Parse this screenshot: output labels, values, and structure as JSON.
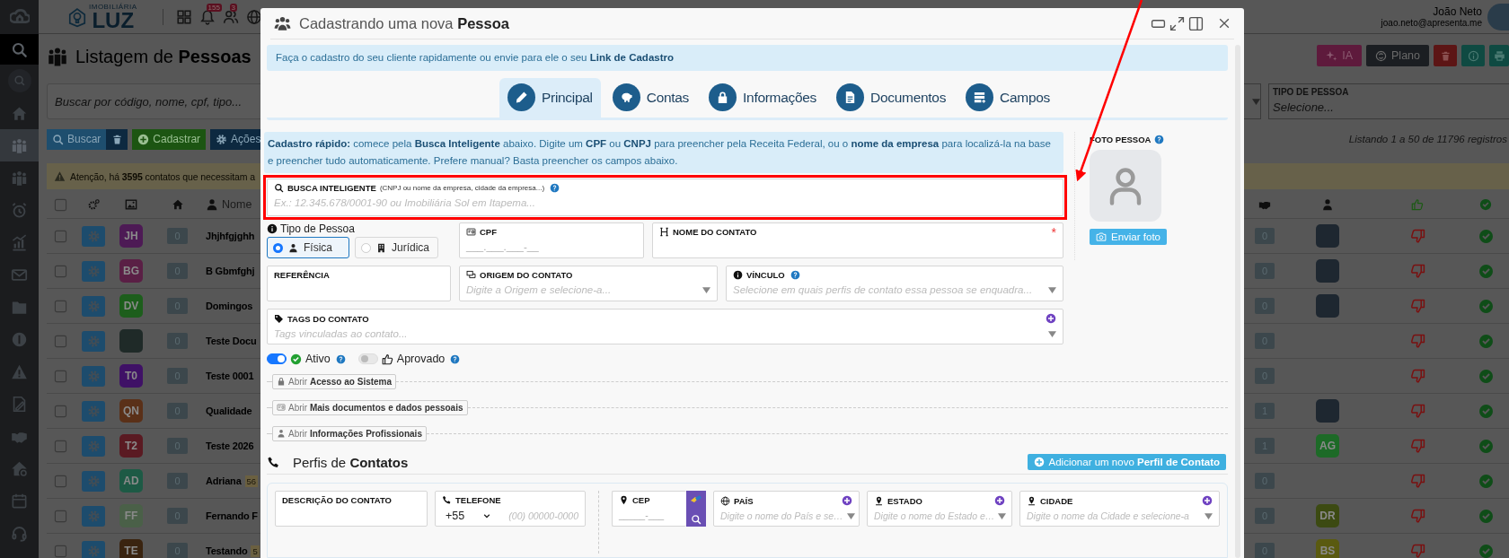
{
  "sidebar": {
    "items": [
      {
        "selected": false
      },
      {
        "selected": false
      },
      {
        "selected": false
      },
      {
        "selected": true
      },
      {
        "selected": false
      },
      {
        "selected": false
      },
      {
        "selected": false
      },
      {
        "selected": false
      },
      {
        "selected": false
      },
      {
        "selected": false
      },
      {
        "selected": false
      },
      {
        "selected": false
      },
      {
        "selected": false
      },
      {
        "selected": false
      },
      {
        "selected": false
      },
      {
        "selected": false
      }
    ]
  },
  "topbar": {
    "logo_small": "IMOBILIÁRIA",
    "logo": "LUZ",
    "badges": [
      "155",
      "3"
    ],
    "user_name": "João Neto",
    "user_email": "joao.neto@apresenta.me"
  },
  "page": {
    "title": "Listagem de **Pessoas**",
    "top_buttons": [
      "IA",
      "Plano"
    ],
    "search_placeholder": "Buscar por código, nome, cpf, tipo...",
    "filter": {
      "label": "TIPO DE PESSOA",
      "placeholder": "Selecione..."
    },
    "buttons": [
      "Buscar",
      "Cadastrar",
      "Ações"
    ],
    "listing": "Listando 1 a 50 de 11796 registros",
    "warning": "Atenção, há **3595** contatos que necessitam a"
  },
  "table": {
    "all_checked": false,
    "name_column": "Nome",
    "rows": [
      {
        "checked": false,
        "avatar": {
          "kind": "initials",
          "initials": "JH",
          "color": "#4d1a55"
        },
        "count": "0",
        "name": "Jhjhfgjghh",
        "right_count": "0",
        "owner": {
          "kind": "photo"
        },
        "approved": false,
        "active": true
      },
      {
        "checked": false,
        "avatar": {
          "kind": "initials",
          "initials": "BG",
          "color": "#5a1f45"
        },
        "count": "0",
        "name": "B Gbmfghj",
        "right_count": "0",
        "owner": {
          "kind": "photo"
        },
        "approved": false,
        "active": true
      },
      {
        "checked": false,
        "avatar": {
          "kind": "initials",
          "initials": "DV",
          "color": "#1d5e1c"
        },
        "count": "0",
        "name": "Domingos",
        "right_count": "0",
        "owner": {
          "kind": "photo"
        },
        "approved": false,
        "active": true
      },
      {
        "checked": false,
        "avatar": {
          "kind": "photo"
        },
        "count": "0",
        "name": "Teste Docu",
        "right_count": "0",
        "approved": false,
        "active": true
      },
      {
        "checked": false,
        "avatar": {
          "kind": "initials",
          "initials": "T0",
          "color": "#3f1166"
        },
        "count": "0",
        "name": "Teste 0001",
        "right_count": "0",
        "approved": false,
        "active": true
      },
      {
        "checked": false,
        "avatar": {
          "kind": "initials",
          "initials": "QN",
          "color": "#5a3018"
        },
        "count": "0",
        "name": "Qualidade",
        "right_count": "1",
        "owner": {
          "kind": "photo"
        },
        "approved": false,
        "active": true
      },
      {
        "checked": false,
        "avatar": {
          "kind": "initials",
          "initials": "T2",
          "color": "#5a1a22"
        },
        "count": "0",
        "name": "Teste 2026",
        "right_count": "1",
        "owner": {
          "kind": "initials",
          "initials": "AG",
          "color": "#1d6a27"
        },
        "approved": false,
        "active": true
      },
      {
        "checked": false,
        "avatar": {
          "kind": "initials",
          "initials": "AD",
          "color": "#1d5a45"
        },
        "count": "0",
        "name": "Adriana",
        "badge": "56",
        "right_count": "0",
        "approved": false,
        "active": true
      },
      {
        "checked": false,
        "avatar": {
          "kind": "initials",
          "initials": "FF",
          "color": "#4a6048"
        },
        "count": "0",
        "name": "Fernando F",
        "right_count": "0",
        "owner": {
          "kind": "initials",
          "initials": "DR",
          "color": "#3c4a12"
        },
        "approved": false,
        "active": true
      },
      {
        "checked": false,
        "avatar": {
          "kind": "initials",
          "initials": "TE",
          "color": "#3a2410"
        },
        "count": "0",
        "name": "Testando",
        "badge": "5",
        "right_count": "0",
        "owner": {
          "kind": "initials",
          "initials": "BS",
          "color": "#5a5a10"
        },
        "approved": false,
        "active": true
      }
    ]
  },
  "modal": {
    "title": "Cadastrando uma nova **Pessoa**",
    "notice": "Faça o cadastro do seu cliente rapidamente ou envie para ele o seu **Link de Cadastro**",
    "tabs": [
      {
        "label": "Principal",
        "selected": true
      },
      {
        "label": "Contas",
        "selected": false
      },
      {
        "label": "Informações",
        "selected": false
      },
      {
        "label": "Documentos",
        "selected": false
      },
      {
        "label": "Campos",
        "selected": false
      }
    ],
    "quick_tip": "**Cadastro rápido:** comece pela **Busca Inteligente** abaixo. Digite um **CPF** ou **CNPJ** para preencher pela Receita Federal, ou o **nome da empresa** para localizá-la na base e preencher tudo automaticamente. Prefere manual? Basta preencher os campos abaixo.",
    "smart_search": {
      "label": "BUSCA INTELIGENTE",
      "hint": "(CNPJ ou nome da empresa, cidade da empresa...)",
      "placeholder": "Ex.: 12.345.678/0001-90 ou Imobiliária Sol em Itapema..."
    },
    "person_type": {
      "label": "Tipo de Pessoa",
      "options": [
        {
          "label": "Física",
          "selected": true
        },
        {
          "label": "Jurídica",
          "selected": false
        }
      ]
    },
    "cpf": {
      "label": "CPF",
      "placeholder": "___.___.___-__"
    },
    "contact_name": {
      "label": "NOME DO CONTATO",
      "required_mark": "*"
    },
    "reference": {
      "label": "REFERÊNCIA"
    },
    "origin": {
      "label": "ORIGEM DO CONTATO",
      "placeholder": "Digite a Origem e selecione-a..."
    },
    "link": {
      "label": "VÍNCULO",
      "placeholder": "Selecione em quais perfis de contato essa pessoa se enquadra..."
    },
    "tags": {
      "label": "TAGS DO CONTATO",
      "placeholder": "Tags vinculadas ao contato..."
    },
    "toggles": [
      {
        "label": "Ativo",
        "on": true
      },
      {
        "label": "Aprovado",
        "on": false
      }
    ],
    "sections": [
      "Abrir **Acesso ao Sistema**",
      "Abrir **Mais documentos e dados pessoais**",
      "Abrir **Informações Profissionais**"
    ],
    "photo": {
      "label": "FOTO PESSOA",
      "button": "Enviar foto"
    },
    "profiles": {
      "title": "Perfis de **Contatos**",
      "add_button": "Adicionar um novo **Perfil de Contato**",
      "description": {
        "label": "DESCRIÇÃO DO CONTATO"
      },
      "phone": {
        "label": "TELEFONE",
        "prefix": "+55",
        "placeholder": "(00) 00000-0000"
      },
      "cep": {
        "label": "CEP",
        "placeholder": "_____-___"
      },
      "country": {
        "label": "PAÍS",
        "placeholder": "Digite o nome do País e se…"
      },
      "state": {
        "label": "ESTADO",
        "placeholder": "Digite o nome do Estado e…"
      },
      "city": {
        "label": "CIDADE",
        "placeholder": "Digite o nome da Cidade e selecione-a"
      }
    }
  }
}
